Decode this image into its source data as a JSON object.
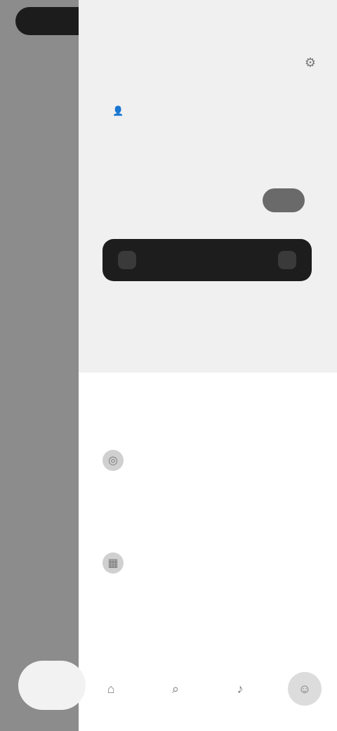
{
  "drawer": {
    "account_label": "",
    "small_link": "",
    "headline": "",
    "cta_label": "",
    "big_text": [
      "",
      ""
    ],
    "subtext": ""
  },
  "sections": [
    {
      "label": "",
      "item_label": ""
    },
    {
      "label": "",
      "item_label": ""
    }
  ],
  "footer_label": "",
  "icons": {
    "settings": "gear-icon",
    "small_link": "person-icon",
    "item_1": "globe-icon",
    "item_2": "grid-icon"
  }
}
